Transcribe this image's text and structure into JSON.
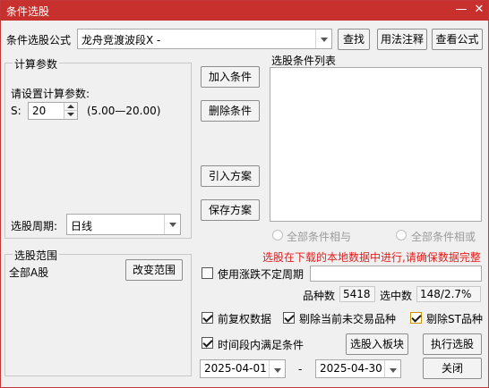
{
  "window": {
    "title": "条件选股"
  },
  "formula": {
    "label": "条件选股公式",
    "value": "龙舟竞渡波段X  -"
  },
  "buttons": {
    "find": "查找",
    "usage": "用法注释",
    "view_formula": "查看公式",
    "add_condition": "加入条件",
    "delete_condition": "删除条件",
    "import_plan": "引入方案",
    "save_plan": "保存方案",
    "change_range": "改变范围",
    "select_to_block": "选股入板块",
    "execute": "执行选股",
    "close": "关闭"
  },
  "calc_params": {
    "group_label": "计算参数",
    "prompt": "请设置计算参数:",
    "param_name": "S:",
    "param_value": "20",
    "param_range": "(5.00—20.00)",
    "period_label": "选股周期:",
    "period_value": "日线"
  },
  "condition_list": {
    "label": "选股条件列表"
  },
  "logic": {
    "all_and": "全部条件相与",
    "all_or": "全部条件相或"
  },
  "range": {
    "group_label": "选股范围",
    "value": "全部A股"
  },
  "notice": "选股在下载的本地数据中进行,请确保数据完整",
  "options": {
    "variable_period_label": "使用涨跌不定周期",
    "variable_period_checked": false,
    "forward_adjust_label": "前复权数据",
    "forward_adjust_checked": true,
    "exclude_untraded_label": "剔除当前未交易品种",
    "exclude_untraded_checked": true,
    "exclude_st_label": "剔除ST品种",
    "exclude_st_checked": true,
    "time_range_label": "时间段内满足条件",
    "time_range_checked": true
  },
  "stats": {
    "count_label": "品种数",
    "count_value": "5418",
    "selected_label": "选中数",
    "selected_value": "148/2.7%"
  },
  "dates": {
    "start": "2025-04-01",
    "separator": "-",
    "end": "2025-04-30"
  },
  "colors": {
    "titlebar": "#c8302e",
    "notice": "#e02020"
  }
}
